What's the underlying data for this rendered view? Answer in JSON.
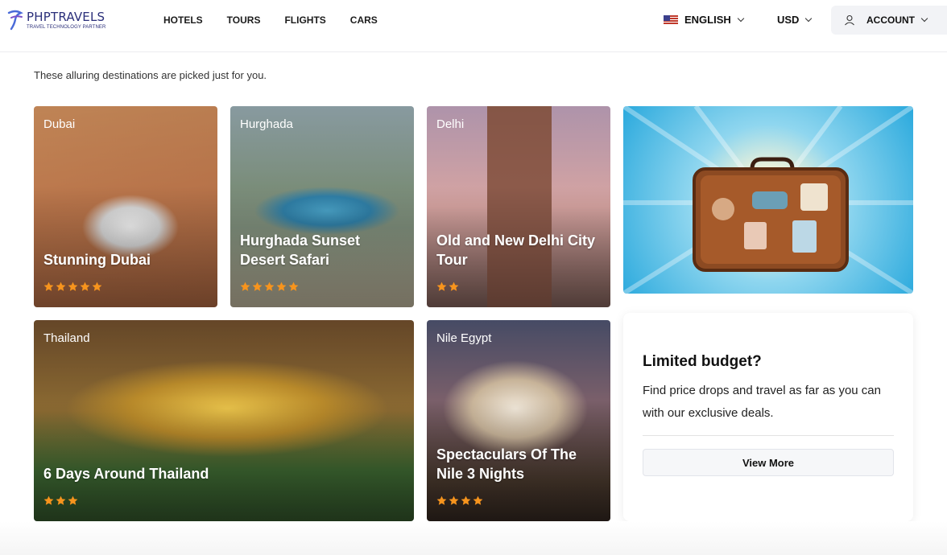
{
  "brand": {
    "name": "PHPTRAVELS",
    "tagline": "TRAVEL TECHNOLOGY PARTNER"
  },
  "nav": {
    "items": [
      {
        "label": "HOTELS"
      },
      {
        "label": "TOURS"
      },
      {
        "label": "FLIGHTS"
      },
      {
        "label": "CARS"
      }
    ]
  },
  "header": {
    "language": "ENGLISH",
    "currency": "USD",
    "account": "ACCOUNT"
  },
  "section": {
    "subtitle": "These alluring destinations are picked just for you."
  },
  "cards": [
    {
      "location": "Dubai",
      "title": "Stunning Dubai",
      "stars": 5
    },
    {
      "location": "Hurghada",
      "title": "Hurghada Sunset Desert Safari",
      "stars": 5
    },
    {
      "location": "Delhi",
      "title": "Old and New Delhi City Tour",
      "stars": 2
    },
    {
      "location": "Thailand",
      "title": "6 Days Around Thailand",
      "stars": 3
    },
    {
      "location": "Nile Egypt",
      "title": "Spectaculars Of The Nile 3 Nights",
      "stars": 4
    }
  ],
  "budget": {
    "heading": "Limited budget?",
    "text": "Find price drops and travel as far as you can with our exclusive deals.",
    "button": "View More"
  },
  "colors": {
    "star": "#f7941d",
    "brand": "#2b2f7a"
  },
  "icons": {
    "logo": "phptravels-logo-icon",
    "flag": "us-flag-icon",
    "account": "user-icon",
    "chevron": "chevron-down-icon",
    "star": "star-icon"
  }
}
